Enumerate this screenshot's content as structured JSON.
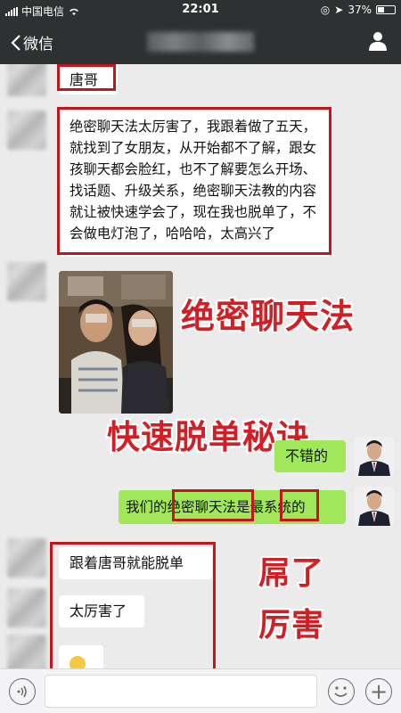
{
  "status_bar": {
    "carrier": "中国电信",
    "time": "22:01",
    "battery": "37%"
  },
  "nav": {
    "back_label": "微信"
  },
  "messages": {
    "m1": "唐哥",
    "m2": "绝密聊天法太厉害了，我跟着做了五天，就找到了女朋友，从开始都不了解，跟女孩聊天都会脸红，也不了解要怎么开场、找话题、升级关系，绝密聊天法教的内容就让被快速学会了，现在我也脱单了，不会做电灯泡了，哈哈哈，太高兴了",
    "m3": "不错的",
    "m4_a": "我们的",
    "m4_b": "绝密聊天法",
    "m4_c": "是最",
    "m4_d": "系统",
    "m4_e": "的",
    "m5": "跟着唐哥就能脱单",
    "m6": "太厉害了"
  },
  "overlays": {
    "title1": "绝密聊天法",
    "title2": "快速脱单秘诀",
    "title3": "屌了",
    "title4": "厉害"
  },
  "colors": {
    "nav_bg": "#2e3132",
    "chat_bg": "#ebebeb",
    "self_bubble": "#a0e75a",
    "highlight_red": "#c4151c"
  }
}
